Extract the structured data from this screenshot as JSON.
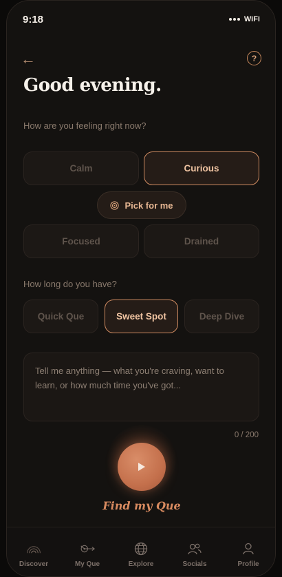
{
  "status_bar": {
    "time": "9:18",
    "network": "WiFi"
  },
  "header": {
    "back_glyph": "←",
    "help_glyph": "?"
  },
  "greeting": "Good evening.",
  "mood": {
    "prompt": "How are you feeling right now?",
    "options": [
      {
        "label": "Calm",
        "selected": false
      },
      {
        "label": "Curious",
        "selected": true
      },
      {
        "label": "Focused",
        "selected": false
      },
      {
        "label": "Drained",
        "selected": false
      }
    ],
    "pick_label": "Pick for me"
  },
  "duration": {
    "prompt": "How long do you have?",
    "options": [
      {
        "label": "Quick Que",
        "selected": false
      },
      {
        "label": "Sweet Spot",
        "selected": true
      },
      {
        "label": "Deep Dive",
        "selected": false
      }
    ]
  },
  "input": {
    "value": "",
    "placeholder": "Tell me anything — what you're craving, want to learn, or how much time you've got...",
    "counter": "0 / 200"
  },
  "action": {
    "label": "Find my Que"
  },
  "tabbar": {
    "items": [
      {
        "label": "Discover",
        "icon": "rainbow-icon"
      },
      {
        "label": "My Que",
        "icon": "compass-arrow-icon"
      },
      {
        "label": "Explore",
        "icon": "globe-icon"
      },
      {
        "label": "Socials",
        "icon": "people-icon"
      },
      {
        "label": "Profile",
        "icon": "person-icon"
      }
    ]
  },
  "colors": {
    "accent": "#d08c62",
    "accent_text": "#f0c4a2",
    "background": "#141210",
    "chip": "#1c1815"
  }
}
